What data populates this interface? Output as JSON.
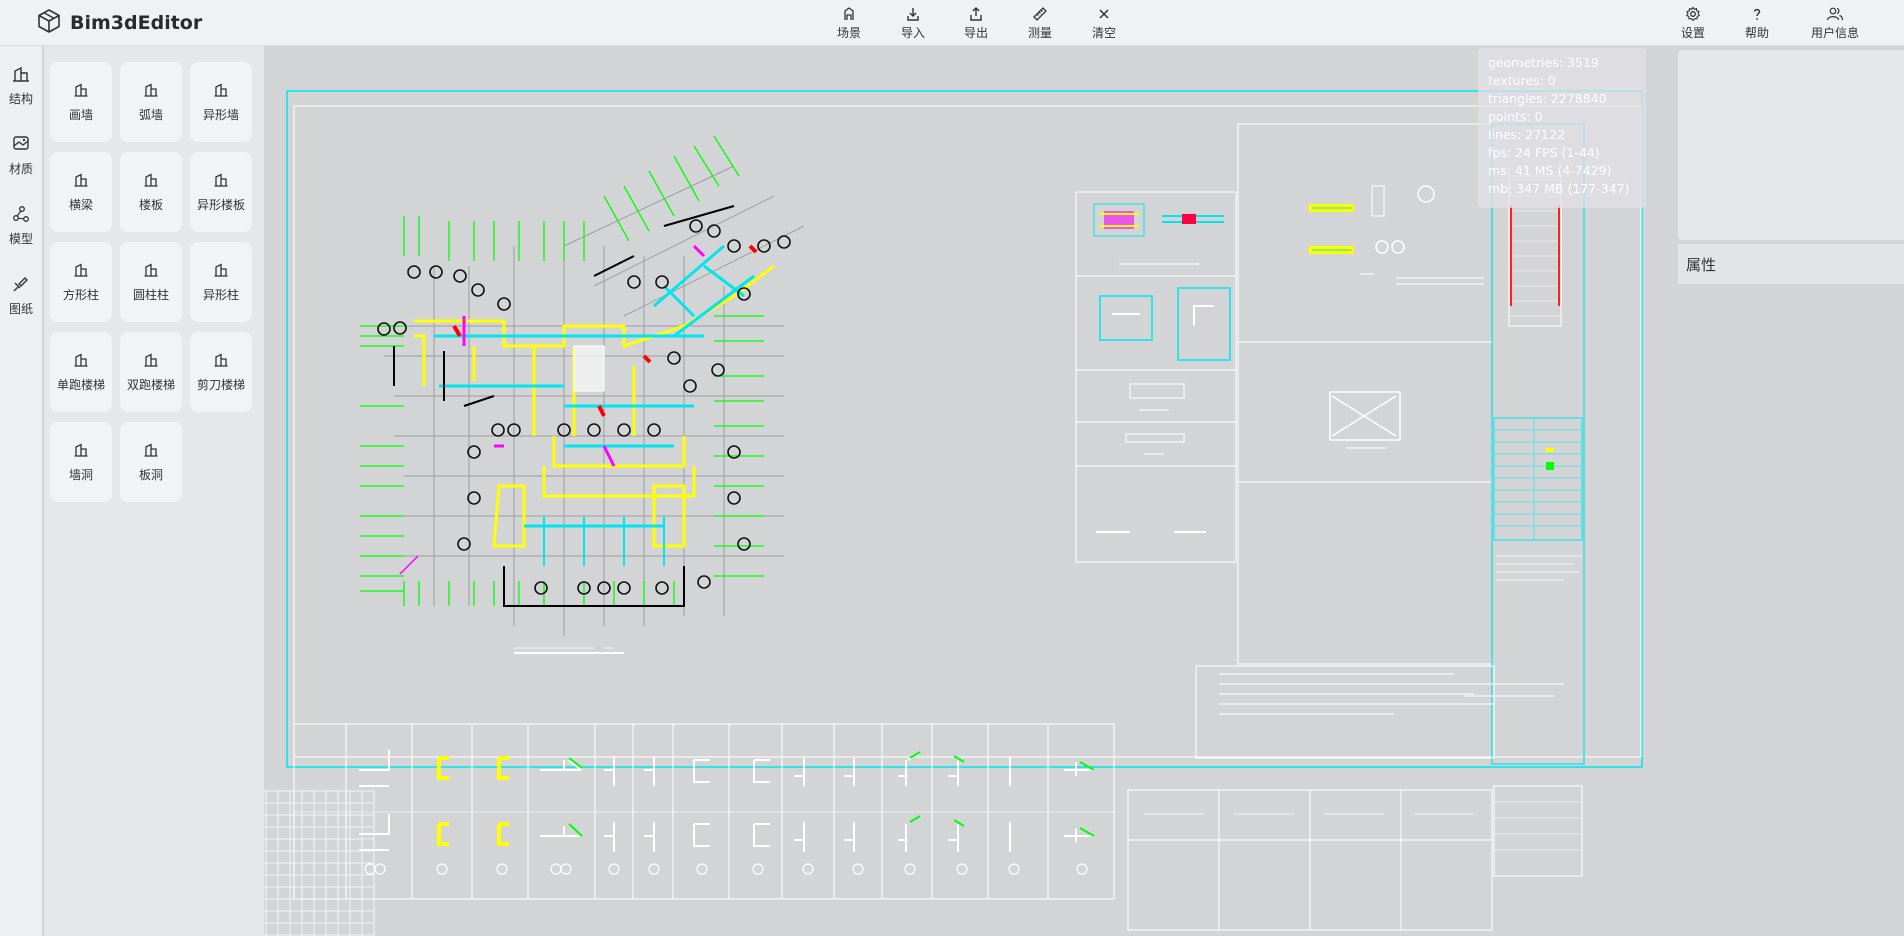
{
  "app": {
    "title": "Bim3dEditor"
  },
  "toolbar": {
    "items": [
      {
        "label": "场景",
        "icon": "scene-icon"
      },
      {
        "label": "导入",
        "icon": "import-icon"
      },
      {
        "label": "导出",
        "icon": "export-icon"
      },
      {
        "label": "测量",
        "icon": "ruler-icon"
      },
      {
        "label": "清空",
        "icon": "close-icon"
      }
    ],
    "right_items": [
      {
        "label": "设置",
        "icon": "gear-icon"
      },
      {
        "label": "帮助",
        "icon": "help-icon"
      },
      {
        "label": "用户信息",
        "icon": "users-icon"
      }
    ]
  },
  "leftnav": {
    "items": [
      {
        "label": "结构",
        "icon": "structure-icon"
      },
      {
        "label": "材质",
        "icon": "material-icon"
      },
      {
        "label": "模型",
        "icon": "model-icon"
      },
      {
        "label": "图纸",
        "icon": "drawing-icon"
      }
    ]
  },
  "palette": {
    "items": [
      {
        "label": "画墙"
      },
      {
        "label": "弧墙"
      },
      {
        "label": "异形墙"
      },
      {
        "label": "横梁"
      },
      {
        "label": "楼板"
      },
      {
        "label": "异形楼板"
      },
      {
        "label": "方形柱"
      },
      {
        "label": "圆柱柱"
      },
      {
        "label": "异形柱"
      },
      {
        "label": "单跑楼梯"
      },
      {
        "label": "双跑楼梯"
      },
      {
        "label": "剪刀楼梯"
      },
      {
        "label": "墙洞"
      },
      {
        "label": "板洞"
      }
    ]
  },
  "stats": {
    "geometries": "geometries:  3519",
    "textures": "textures:  0",
    "triangles": "triangles:  2278840",
    "points": "points:  0",
    "lines": "lines:  27122",
    "fps": "fps:  24 FPS (1-44)",
    "ms": "ms:  41 MS (4-7429)",
    "mb": "mb:  347 MB (177-347)"
  },
  "properties": {
    "header": "属性"
  },
  "colors": {
    "accent_cyan": "#00e5ee",
    "cad_yellow": "#ffff00",
    "cad_green": "#00ff00",
    "cad_magenta": "#ff00ff",
    "cad_red": "#ff0000"
  }
}
